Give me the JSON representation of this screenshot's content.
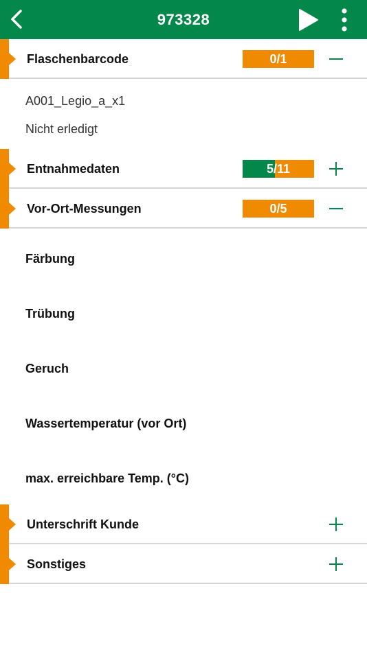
{
  "header": {
    "title": "973328",
    "back_icon": "chevron-left-icon",
    "play_icon": "play-icon",
    "more_icon": "more-vertical-icon"
  },
  "sections": {
    "flaschenbarcode": {
      "label": "Flaschenbarcode",
      "progress": "0/1",
      "fill_fraction": 0,
      "expanded": true
    },
    "entnahmedaten": {
      "label": "Entnahmedaten",
      "progress": "5/11",
      "fill_fraction": 0.4545,
      "expanded": false
    },
    "vor_ort": {
      "label": "Vor-Ort-Messungen",
      "progress": "0/5",
      "fill_fraction": 0,
      "expanded": true
    },
    "unterschrift": {
      "label": "Unterschrift Kunde",
      "expanded": false
    },
    "sonstiges": {
      "label": "Sonstiges",
      "expanded": false
    }
  },
  "barcode_details": {
    "code": "A001_Legio_a_x1",
    "status": "Nicht erledigt"
  },
  "measurements": [
    "Färbung",
    "Trübung",
    "Geruch",
    "Wassertemperatur (vor Ort)",
    "max. erreichbare Temp. (°C)"
  ],
  "colors": {
    "header_green": "#04874a",
    "accent_orange": "#f08a00",
    "progress_green": "#04874a"
  }
}
